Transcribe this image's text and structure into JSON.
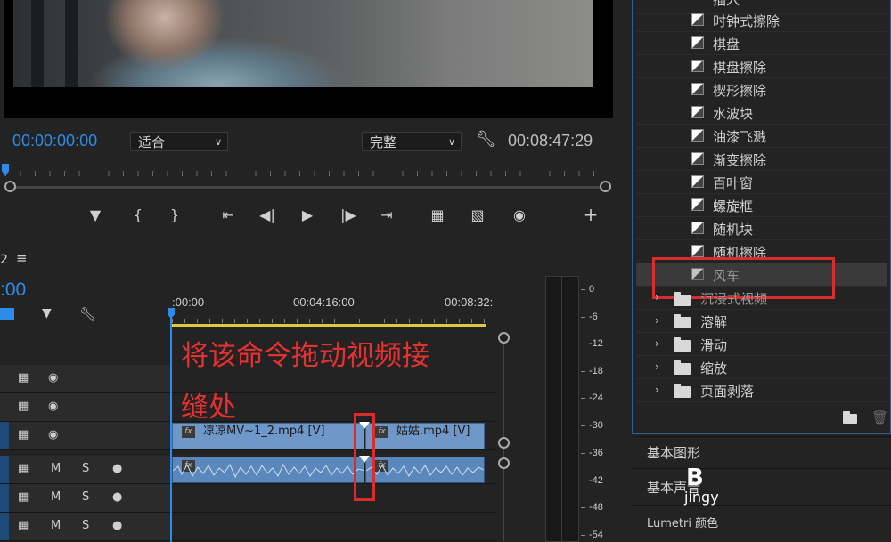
{
  "monitor": {
    "timecode_current": "00:00:00:00",
    "timecode_duration": "00:08:47:29",
    "fit_dropdown": "适合",
    "quality_dropdown": "完整"
  },
  "timeline": {
    "sequence_number": "2",
    "timecode": ":00",
    "ruler_labels": [
      ":00:00",
      "00:04:16:00",
      "00:08:32:"
    ],
    "tracks": {
      "audio_mute": "M",
      "audio_solo": "S"
    },
    "clips": {
      "v1_clip_a": "凉凉MV~1_2.mp4 [V]",
      "v1_clip_b": "姑姑.mp4 [V]",
      "fx_badge": "fx"
    },
    "annotation_line1": "将该命令拖动视频接",
    "annotation_line2": "缝处"
  },
  "meter": {
    "labels": [
      "0",
      "-6",
      "-12",
      "-18",
      "-24",
      "-30",
      "-36",
      "-42",
      "-48",
      "-54"
    ]
  },
  "effects": {
    "transitions": [
      "插入",
      "时钟式擦除",
      "棋盘",
      "棋盘擦除",
      "楔形擦除",
      "水波块",
      "油漆飞溅",
      "渐变擦除",
      "百叶窗",
      "螺旋框",
      "随机块",
      "随机擦除",
      "风车"
    ],
    "folders": [
      "沉浸式视频",
      "溶解",
      "滑动",
      "缩放",
      "页面剥落"
    ]
  },
  "panels": {
    "essential_graphics": "基本图形",
    "essential_sound": "基本声音",
    "lumetri": "Lumetri 颜色"
  },
  "watermark": {
    "logo": "B",
    "text": "jingy"
  },
  "colors": {
    "accent_blue": "#2d8ceb",
    "clip_blue": "#6f98c9",
    "annotation_red": "#e43131",
    "work_area_yellow": "#e1c83a"
  }
}
